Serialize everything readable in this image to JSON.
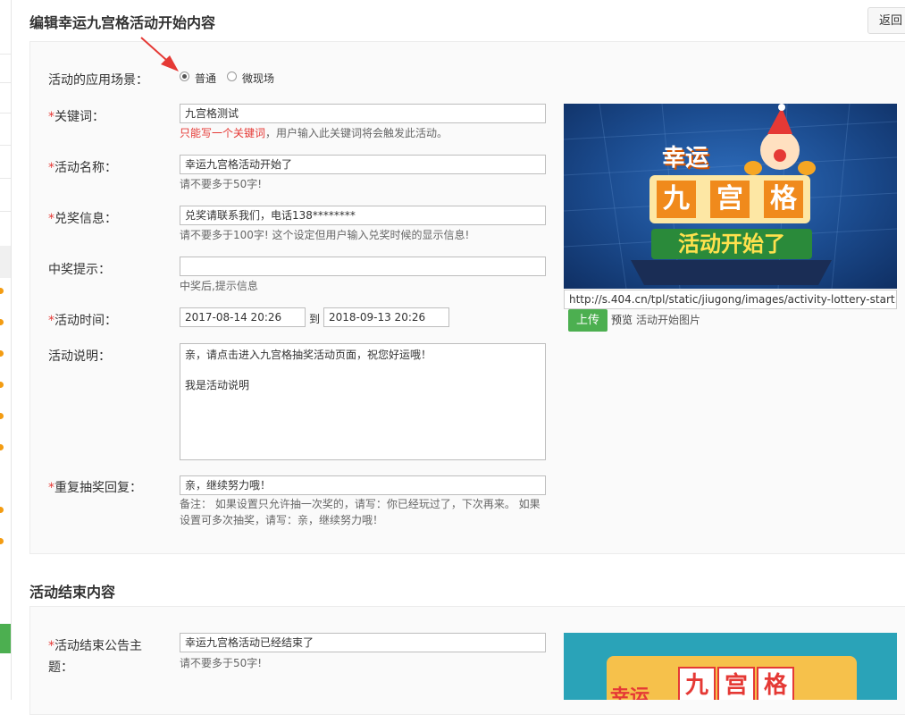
{
  "header": {
    "title": "编辑幸运九宫格活动开始内容",
    "back_label": "返回"
  },
  "scene": {
    "label": "活动的应用场景：",
    "options": [
      "普通",
      "微现场"
    ],
    "selected": "普通"
  },
  "keyword": {
    "required": "*",
    "label": "关键词：",
    "value": "九宫格测试",
    "hint_red": "只能写一个关键词",
    "hint_rest": "，用户输入此关键词将会触发此活动。"
  },
  "activity_name": {
    "required": "*",
    "label": "活动名称：",
    "value": "幸运九宫格活动开始了",
    "hint": "请不要多于50字!"
  },
  "prize_info": {
    "required": "*",
    "label": "兑奖信息：",
    "value": "兑奖请联系我们，电话138********",
    "hint": "请不要多于100字! 这个设定但用户输入兑奖时候的显示信息!"
  },
  "win_tip": {
    "label": "中奖提示：",
    "value": "",
    "hint": "中奖后,提示信息"
  },
  "activity_time": {
    "required": "*",
    "label": "活动时间：",
    "start": "2017-08-14 20:26",
    "sep": "到",
    "end": "2018-09-13 20:26"
  },
  "description": {
    "label": "活动说明：",
    "value": "亲，请点击进入九宫格抽奖活动页面，祝您好运哦！\n\n我是活动说明"
  },
  "repeat_reply": {
    "required": "*",
    "label": "重复抽奖回复：",
    "value": "亲，继续努力哦！",
    "hint_line1": "备注： 如果设置只允许抽一次奖的，请写：你已经玩过了，下次再来。 如果",
    "hint_line2": "设置可多次抽奖，请写：亲，继续努力哦！"
  },
  "start_image": {
    "banner_line1": "幸运",
    "banner_chars": [
      "九",
      "宫",
      "格"
    ],
    "banner_line3": "活动开始了",
    "url": "http://s.404.cn/tpl/static/jiugong/images/activity-lottery-start.jp",
    "upload_label": "上传",
    "preview_label": "预览",
    "caption": "活动开始图片"
  },
  "end_section": {
    "title": "活动结束内容",
    "notice": {
      "required": "*",
      "label_line1": "活动结束公告主",
      "label_line2": "题：",
      "value": "幸运九宫格活动已经结束了",
      "hint": "请不要多于50字!"
    },
    "banner_line1": "幸运",
    "banner_chars": [
      "九",
      "宫",
      "格"
    ]
  },
  "colors": {
    "required": "#e53935",
    "upload": "#4caf50",
    "arrow": "#e53935"
  }
}
